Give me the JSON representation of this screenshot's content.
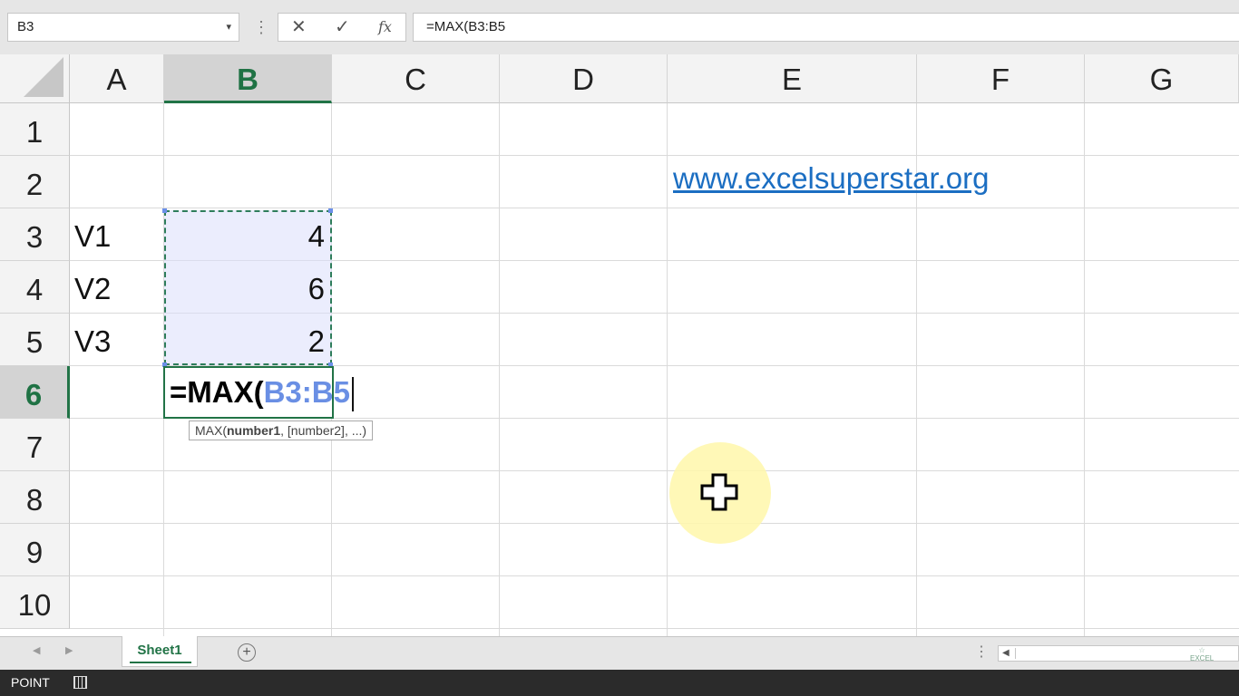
{
  "formula_bar": {
    "name_box": "B3",
    "name_box_arrow": "▾",
    "dots": "⋮",
    "cancel_glyph": "✕",
    "enter_glyph": "✓",
    "fx_glyph": "fx",
    "formula": "=MAX(B3:B5"
  },
  "columns": [
    "A",
    "B",
    "C",
    "D",
    "E",
    "F",
    "G"
  ],
  "selected_column": "B",
  "rows": [
    "1",
    "2",
    "3",
    "4",
    "5",
    "6",
    "7",
    "8",
    "9",
    "10"
  ],
  "selected_row": "6",
  "cells": {
    "A3": "V1",
    "A4": "V2",
    "A5": "V3",
    "B3": "4",
    "B4": "6",
    "B5": "2",
    "E2": "www.excelsuperstar.org"
  },
  "edit_cell": {
    "address": "B6",
    "prefix": "=MAX(",
    "reference": "B3:B5"
  },
  "tooltip": {
    "fn": "MAX(",
    "arg_current": "number1",
    "rest": ", [number2], ...)"
  },
  "sheet_tabs": {
    "tabs": [
      "Sheet1"
    ],
    "active": "Sheet1",
    "add_glyph": "+",
    "dots": "⋮",
    "prev_glyph": "◀",
    "next_glyph": "▶",
    "scroll_left_glyph": "◀",
    "watermark": "EXCEL"
  },
  "status_bar": {
    "mode": "POINT"
  },
  "colors": {
    "excel_green": "#217346",
    "reference_blue": "#6a8fe4",
    "link_blue": "#1b6ec2",
    "cursor_highlight": "#fff7aa"
  }
}
